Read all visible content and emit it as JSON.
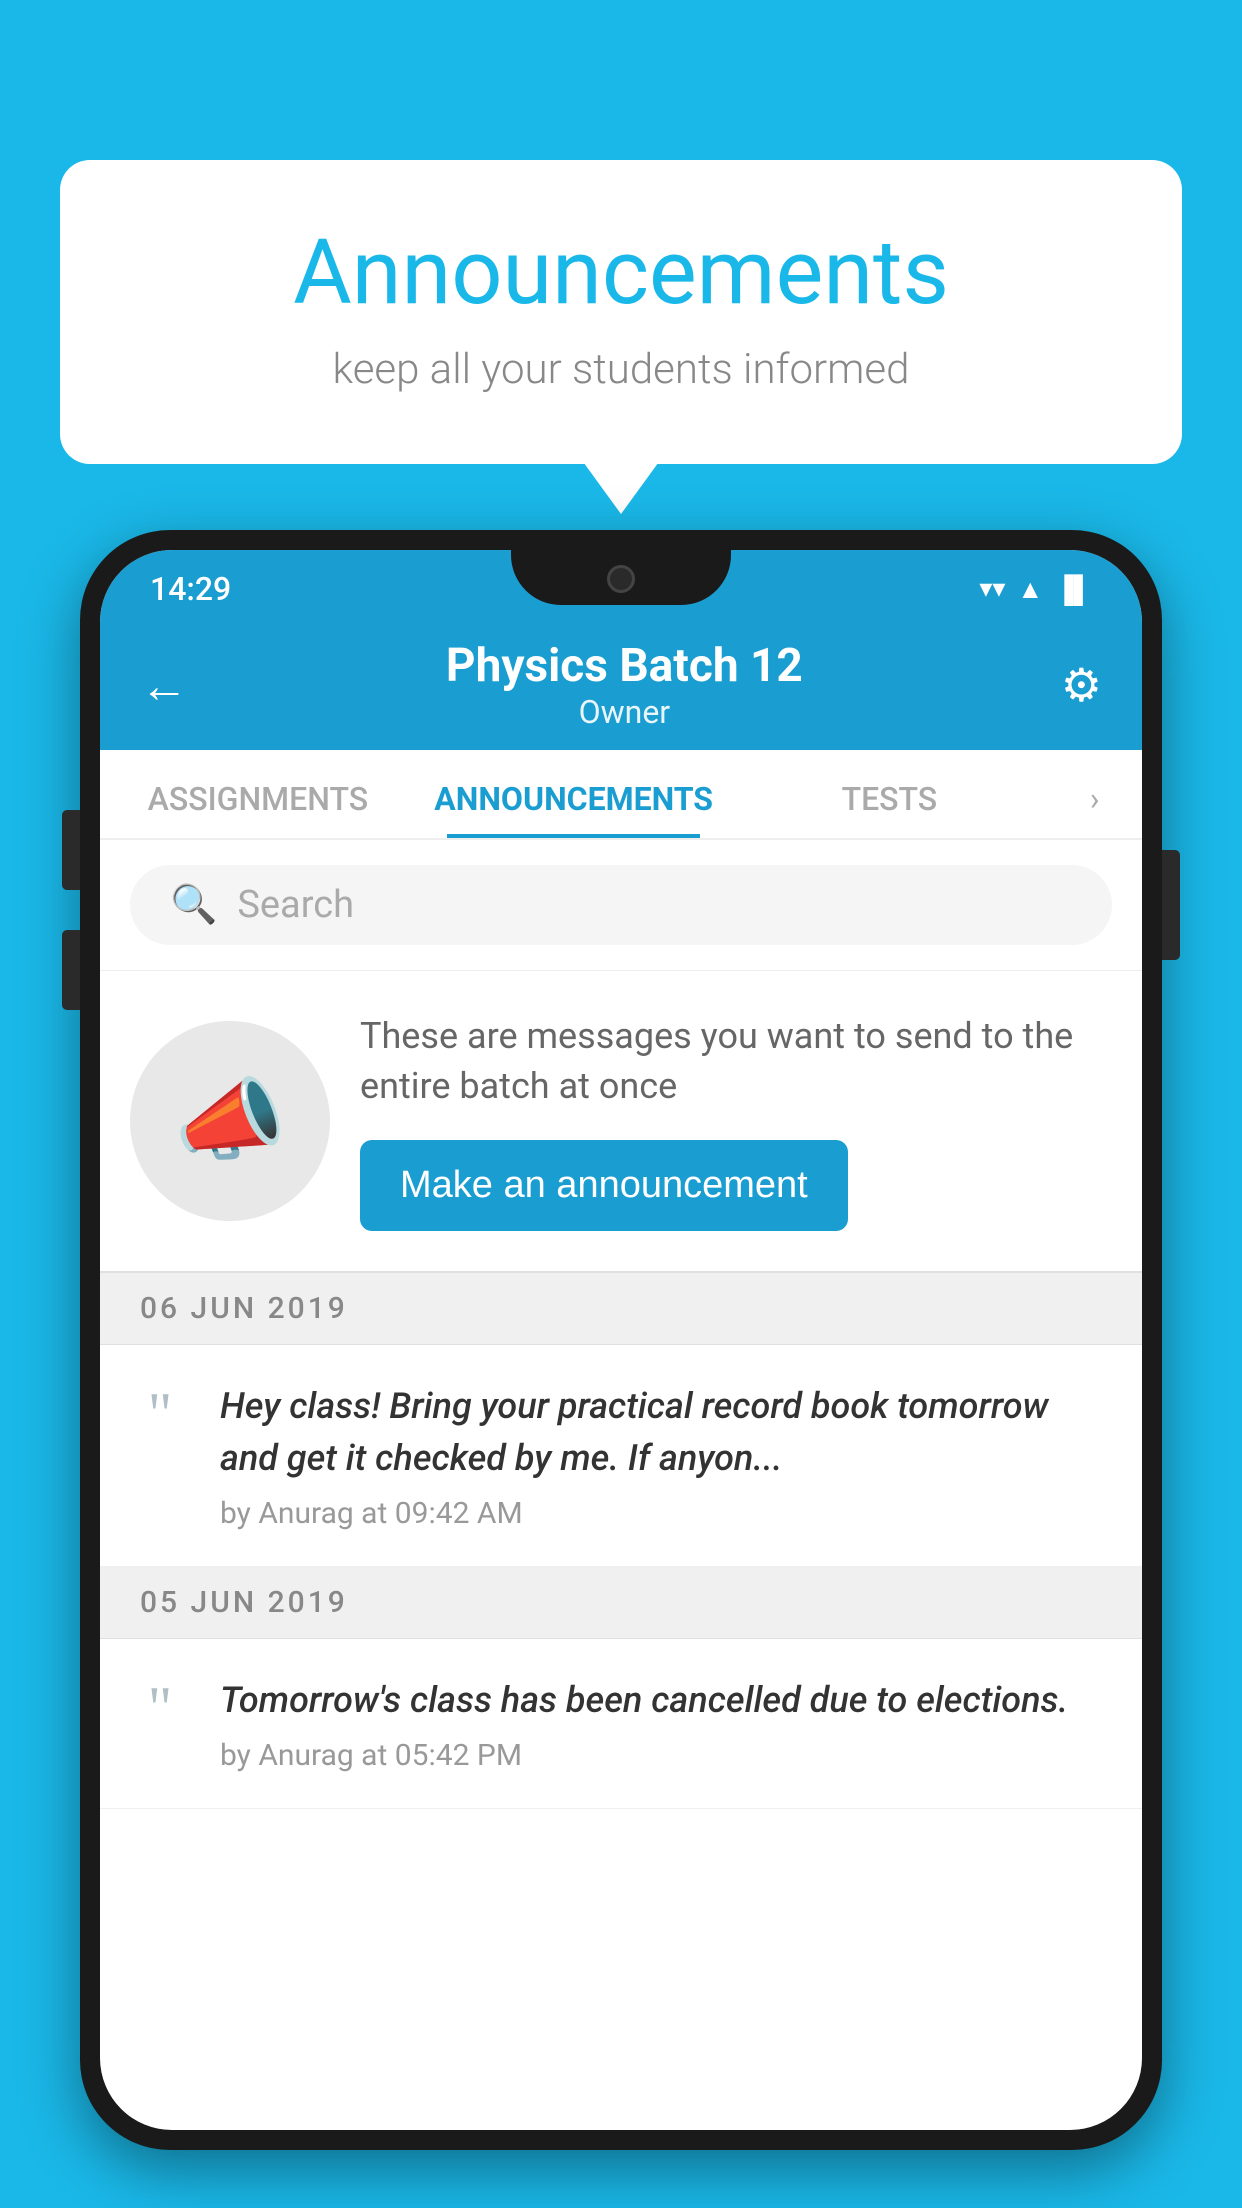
{
  "background_color": "#1ab8e8",
  "speech_bubble": {
    "title": "Announcements",
    "subtitle": "keep all your students informed"
  },
  "phone": {
    "status_bar": {
      "time": "14:29",
      "wifi": "▲",
      "signal": "▲",
      "battery": "▐"
    },
    "header": {
      "back_label": "←",
      "title": "Physics Batch 12",
      "subtitle": "Owner",
      "settings_label": "⚙"
    },
    "tabs": [
      {
        "label": "ASSIGNMENTS",
        "active": false
      },
      {
        "label": "ANNOUNCEMENTS",
        "active": true
      },
      {
        "label": "TESTS",
        "active": false
      }
    ],
    "search": {
      "placeholder": "Search"
    },
    "promo": {
      "description": "These are messages you want to send to the entire batch at once",
      "button_label": "Make an announcement"
    },
    "announcements": [
      {
        "date": "06  JUN  2019",
        "text": "Hey class! Bring your practical record book tomorrow and get it checked by me. If anyon...",
        "meta": "by Anurag at 09:42 AM"
      },
      {
        "date": "05  JUN  2019",
        "text": "Tomorrow's class has been cancelled due to elections.",
        "meta": "by Anurag at 05:42 PM"
      }
    ]
  }
}
